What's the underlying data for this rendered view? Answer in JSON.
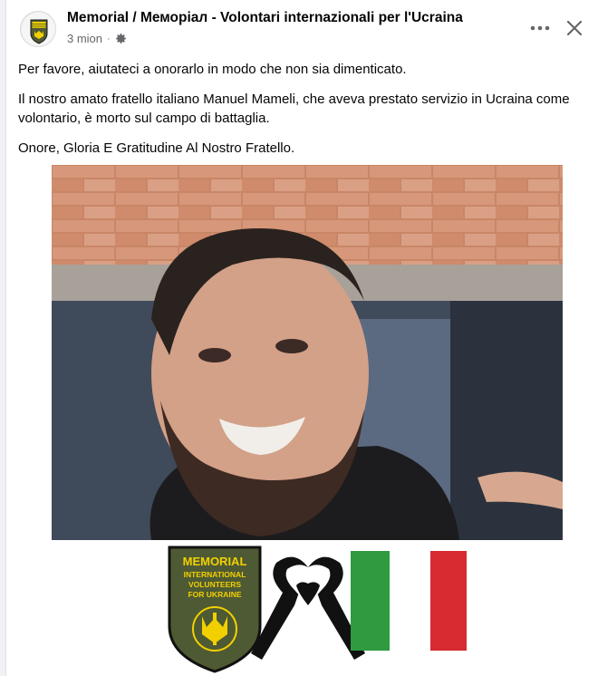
{
  "post": {
    "page_name": "Memorial / Меморіал - Volontari internazionali per l'Ucraina",
    "time": "3 mion",
    "separator": "·",
    "privacy_icon": "gear-icon",
    "menu_icon": "more-dots-icon",
    "close_icon": "close-icon",
    "paragraphs": [
      "Per favore, aiutateci a onorarlo in modo che non sia dimenticato.",
      "Il nostro amato fratello italiano Manuel Mameli, che aveva prestato servizio in Ucraina come volontario, è morto sul campo di battaglia.",
      "Onore, Gloria E Gratitudine Al Nostro Fratello."
    ]
  },
  "emblem": {
    "line1": "MEMORIAL",
    "line2": "INTERNATIONAL",
    "line3": "VOLUNTEERS",
    "line4": "FOR UKRAINE"
  },
  "colors": {
    "text": "#050505",
    "meta": "#65676b",
    "italy_green": "#2f9a3f",
    "italy_white": "#ffffff",
    "italy_red": "#d62b30",
    "emblem_yellow": "#f2d000",
    "emblem_green": "#4e5a33"
  }
}
